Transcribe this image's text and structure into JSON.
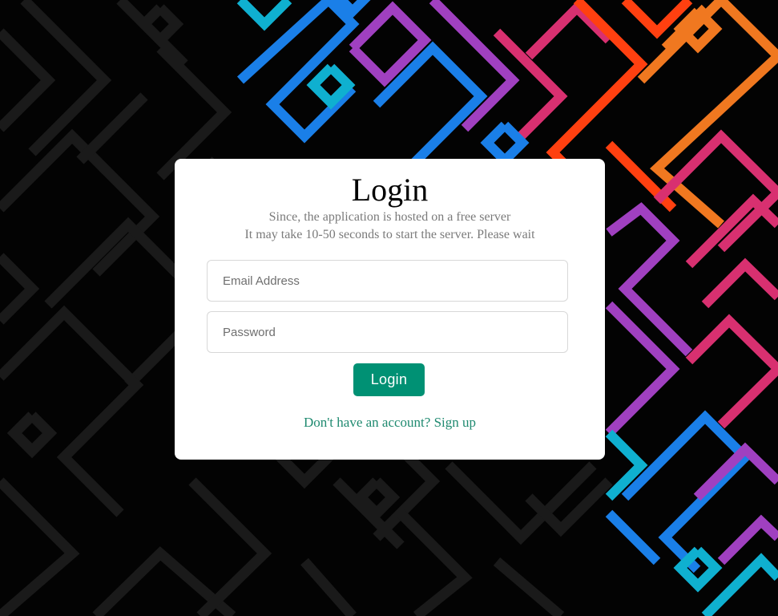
{
  "page": {
    "background_color": "#030303",
    "maze_dark_color": "#1a1a1a",
    "maze_accent_colors": [
      "#0fb0d0",
      "#1a7fe8",
      "#a040c0",
      "#d83070",
      "#ff4010",
      "#f07820"
    ]
  },
  "login_card": {
    "title": "Login",
    "subtitle_line1": "Since, the application is hosted on a free server",
    "subtitle_line2": "It may take 10-50 seconds to start the server. Please wait",
    "email_placeholder": "Email Address",
    "password_placeholder": "Password",
    "login_button_label": "Login",
    "signup_link_text": "Don't have an account? Sign up",
    "accent_color": "#009174"
  }
}
